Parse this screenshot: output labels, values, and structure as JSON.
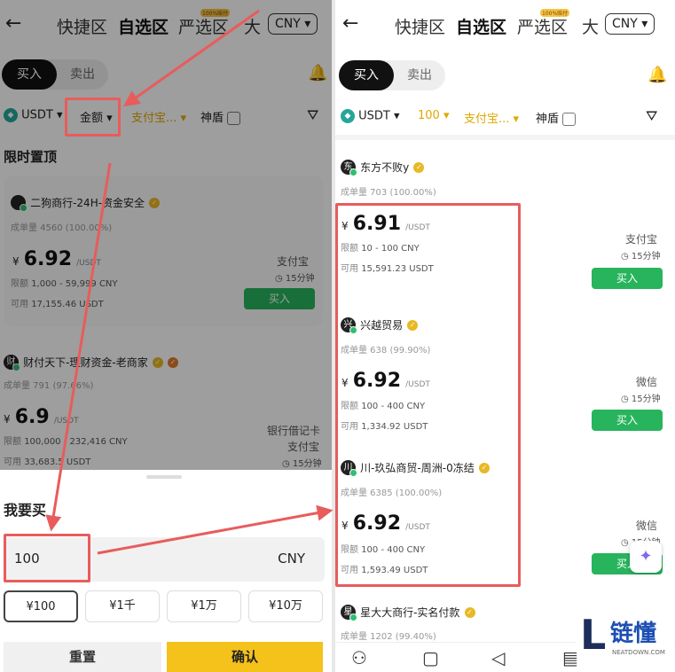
{
  "header": {
    "tabs": [
      "快捷区",
      "自选区",
      "严选区",
      "大"
    ],
    "active_tab": "自选区",
    "badge": "100%赔付",
    "currency": "CNY"
  },
  "trade": {
    "buy": "买入",
    "sell": "卖出"
  },
  "filters_left": {
    "coin": "USDT",
    "amount": "金额",
    "payment": "支付宝...",
    "shield": "神盾"
  },
  "filters_right": {
    "coin": "USDT",
    "amount": "100",
    "payment": "支付宝...",
    "shield": "神盾"
  },
  "left": {
    "section_title": "限时置顶",
    "merchants": [
      {
        "avatar": "",
        "name": "二狗商行-24H-资金安全",
        "orders": "成单量 4560 (100.00%)",
        "price": "6.92",
        "unit": "/USDT",
        "limit": "1,000 - 59,999 CNY",
        "available": "17,155.46 USDT",
        "payment": "支付宝",
        "time": "15分钟",
        "buy": "买入"
      },
      {
        "avatar": "财",
        "name": "财付天下-理财资金-老商家",
        "orders": "成单量 791 (97.66%)",
        "price": "6.9",
        "unit": "/USDT",
        "limit": "100,000 - 232,416 CNY",
        "available": "33,683.5 USDT",
        "payment1": "银行借记卡",
        "payment2": "支付宝",
        "time": "15分钟"
      }
    ],
    "sheet": {
      "title": "我要买",
      "amount": "100",
      "currency": "CNY",
      "chips": [
        "¥100",
        "¥1千",
        "¥1万",
        "¥10万"
      ],
      "reset": "重置",
      "confirm": "确认"
    }
  },
  "right": {
    "merchants": [
      {
        "avatar": "东",
        "name": "东方不败y",
        "orders": "成单量 703 (100.00%)",
        "price": "6.91",
        "unit": "/USDT",
        "limit": "10 - 100 CNY",
        "available": "15,591.23 USDT",
        "payment": "支付宝",
        "time": "15分钟",
        "buy": "买入"
      },
      {
        "avatar": "兴",
        "name": "兴越贸易",
        "orders": "成单量 638 (99.90%)",
        "price": "6.92",
        "unit": "/USDT",
        "limit": "100 - 400 CNY",
        "available": "1,334.92 USDT",
        "payment": "微信",
        "time": "15分钟",
        "buy": "买入"
      },
      {
        "avatar": "川",
        "name": "川-玖弘商贸-周洲-0冻结",
        "orders": "成单量 6385 (100.00%)",
        "price": "6.92",
        "unit": "/USDT",
        "limit": "100 - 400 CNY",
        "available": "1,593.49 USDT",
        "payment": "微信",
        "time": "15分钟",
        "buy": "买入"
      },
      {
        "avatar": "星",
        "name": "星大大商行-实名付款",
        "orders": "成单量 1202 (99.40%)"
      }
    ]
  },
  "labels": {
    "limit": "限额",
    "available": "可用",
    "yuan": "¥"
  },
  "watermark": {
    "name": "链懂",
    "domain": "NEATDOWN.COM"
  },
  "colors": {
    "accent_yellow": "#f4c21a",
    "buy_green": "#27b45d",
    "annotation_red": "#e85c5c"
  }
}
